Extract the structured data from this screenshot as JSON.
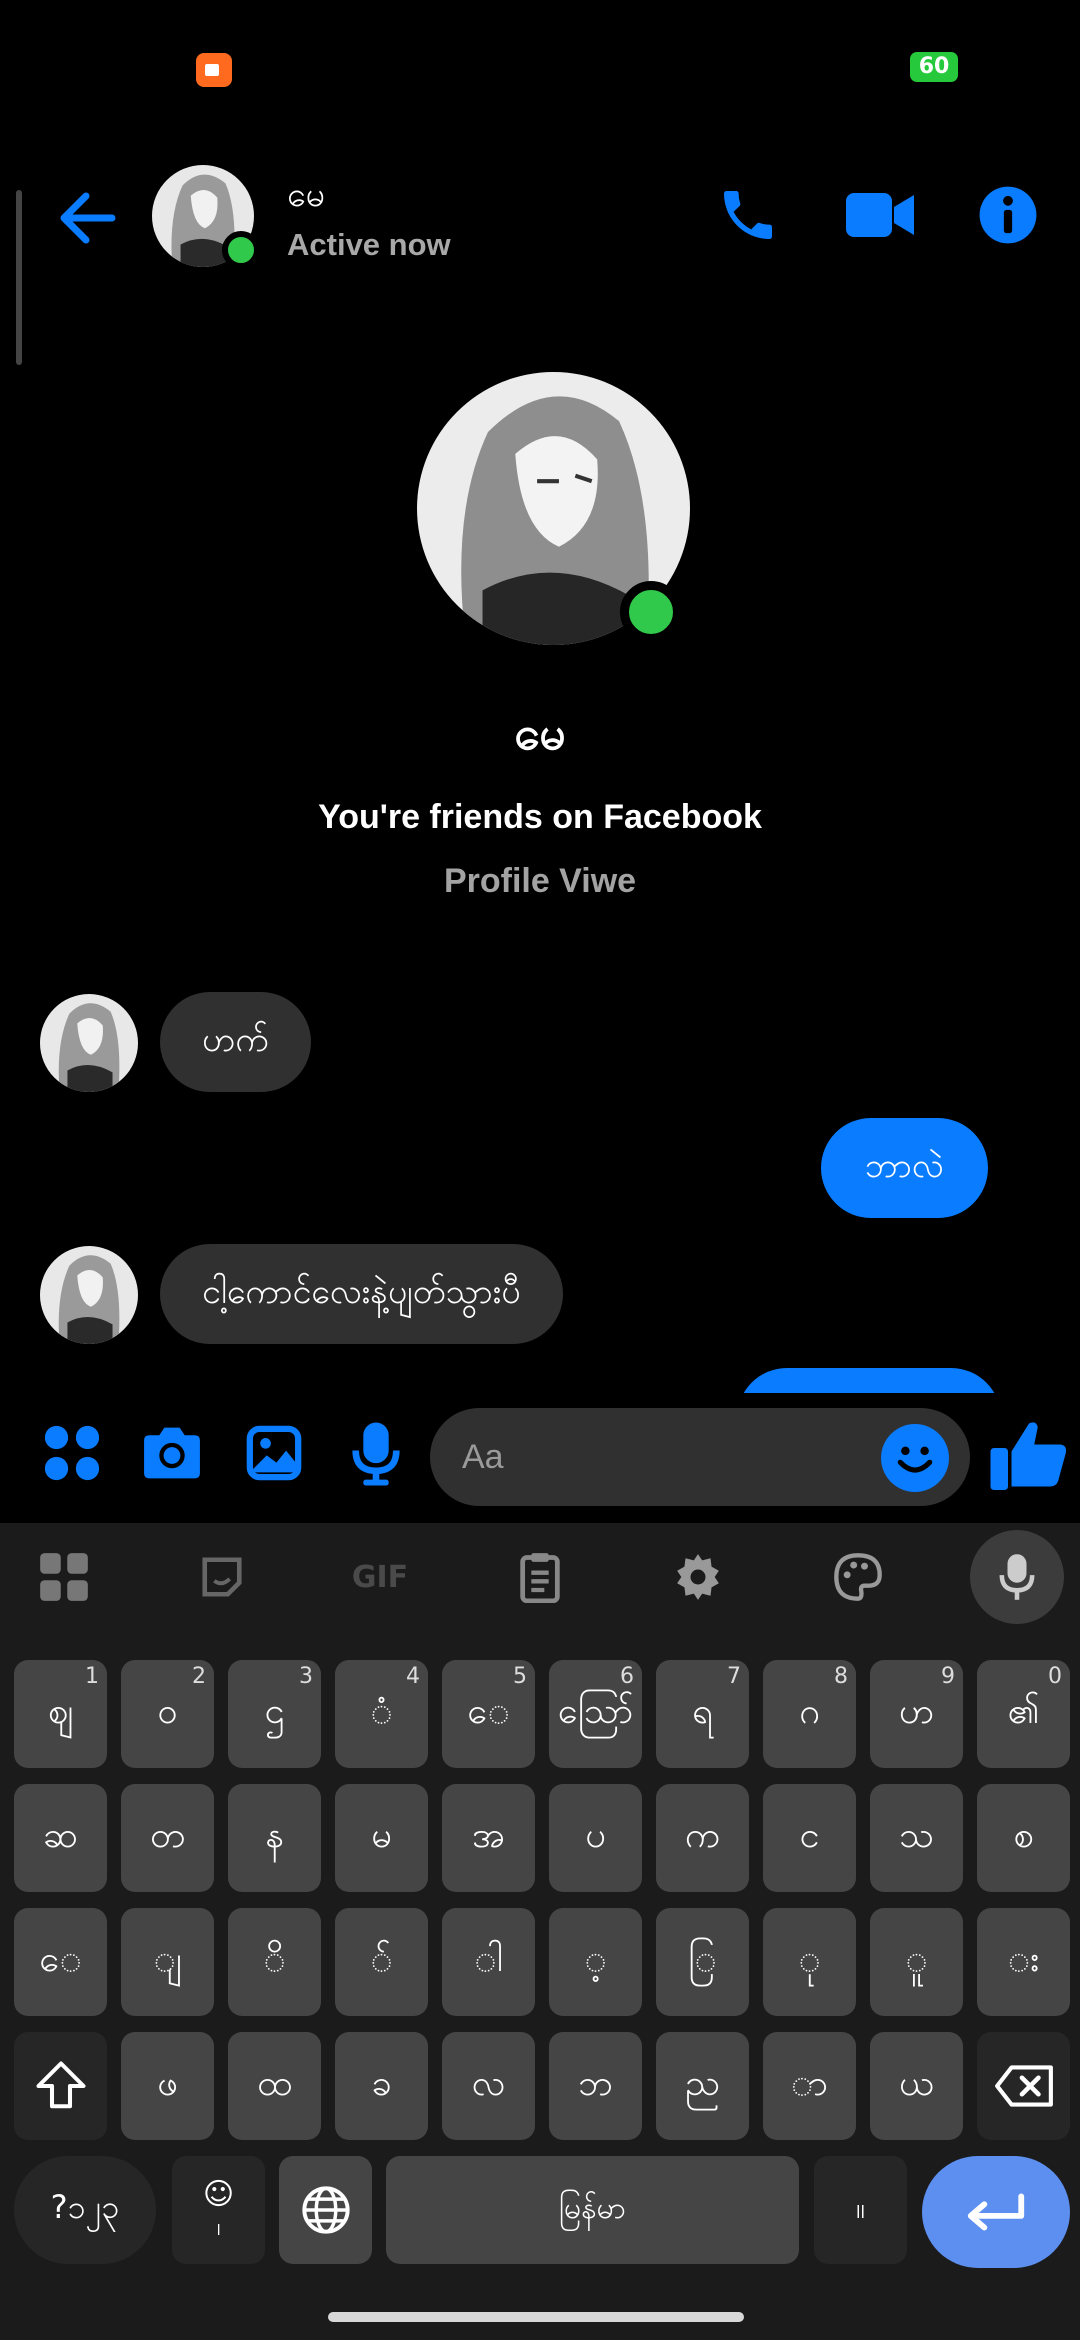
{
  "status_bar": {
    "battery": "60"
  },
  "header": {
    "contact_name": "မေ",
    "status": "Active now"
  },
  "profile": {
    "name": "မေ",
    "friends_text": "You're friends on Facebook",
    "profile_link": "Profile Viwe"
  },
  "messages": [
    {
      "direction": "incoming",
      "text": "ဟက်"
    },
    {
      "direction": "outgoing",
      "text": "ဘာလဲ"
    },
    {
      "direction": "incoming",
      "text": "ငါ့ကောင်လေးနဲ့ပျတ်သွားပီ"
    }
  ],
  "composer": {
    "placeholder": "Aa"
  },
  "keyboard": {
    "toolbar": [
      "apps-icon",
      "sticker-icon",
      "GIF",
      "clipboard-icon",
      "settings-icon",
      "palette-icon",
      "mic-icon"
    ],
    "toolbar_gif": "GIF",
    "row1": [
      {
        "k": "ဈ",
        "h": "1"
      },
      {
        "k": "ဝ",
        "h": "2"
      },
      {
        "k": "ဌ",
        "h": "3"
      },
      {
        "k": "ံ",
        "h": "4"
      },
      {
        "k": "ေ",
        "h": "5"
      },
      {
        "k": "ဪ",
        "h": "6"
      },
      {
        "k": "ရ",
        "h": "7"
      },
      {
        "k": "ဂ",
        "h": "8"
      },
      {
        "k": "ဟ",
        "h": "9"
      },
      {
        "k": "၏",
        "h": "0"
      }
    ],
    "row2": [
      "ဆ",
      "တ",
      "န",
      "မ",
      "အ",
      "ပ",
      "က",
      "င",
      "သ",
      "စ"
    ],
    "row3": [
      "ေ",
      "ျ",
      "ိ",
      "်",
      "ါ",
      "့",
      "ြ",
      "ု",
      "ူ",
      "း"
    ],
    "row4": [
      "ဖ",
      "ထ",
      "ခ",
      "လ",
      "ဘ",
      "ည",
      "ာ",
      "ယ"
    ],
    "symbols_key": "?၁၂၃",
    "emoji_key_sub": "၊",
    "space_label": "မြန်မာ",
    "period_key": "။"
  },
  "colors": {
    "accent": "#0a7cff",
    "online": "#31c94b",
    "bubble_in": "#303030",
    "key": "#454545"
  }
}
